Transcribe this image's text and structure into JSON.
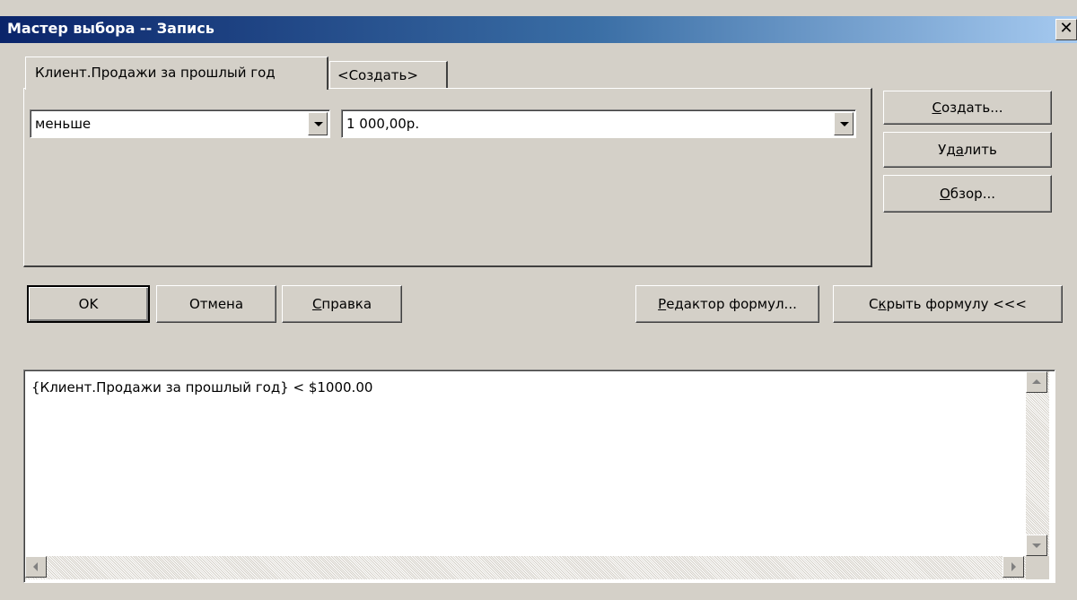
{
  "window": {
    "title": "Мастер выбора -- Запись",
    "close_glyph": "✕"
  },
  "tabs": [
    {
      "label": "Клиент.Продажи за прошлый год",
      "active": true
    },
    {
      "label": "<Создать>",
      "active": false
    }
  ],
  "condition": {
    "operator": "меньше",
    "value": "1 000,00р."
  },
  "side_buttons": {
    "create": {
      "pre": "",
      "key": "С",
      "post": "оздать..."
    },
    "delete": {
      "pre": "Уд",
      "key": "а",
      "post": "лить"
    },
    "browse": {
      "pre": "",
      "key": "О",
      "post": "бзор..."
    }
  },
  "bottom_buttons": {
    "ok": "OK",
    "cancel": "Отмена",
    "help": {
      "pre": "",
      "key": "С",
      "post": "правка"
    },
    "formula_editor": {
      "pre": "",
      "key": "Р",
      "post": "едактор формул..."
    },
    "hide_formula": {
      "pre": "С",
      "key": "к",
      "post": "рыть формулу <<<"
    }
  },
  "formula": {
    "text": "{Клиент.Продажи за прошлый год} < $1000.00"
  },
  "colors": {
    "face": "#d4d0c8",
    "title_start": "#0a246a",
    "title_end": "#a6caf0"
  }
}
